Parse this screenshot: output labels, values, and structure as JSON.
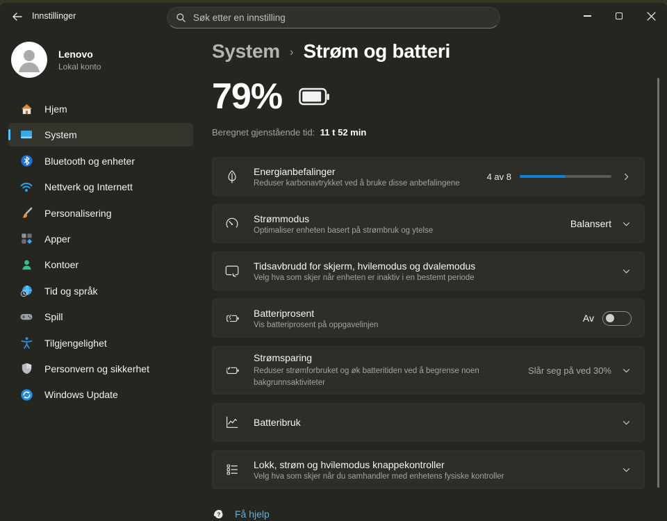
{
  "colors": {
    "accent": "#4cc2ff",
    "progress": "#1180d8",
    "link": "#61b2d8"
  },
  "window": {
    "title": "Innstillinger",
    "search_placeholder": "Søk etter en innstilling"
  },
  "account": {
    "name": "Lenovo",
    "type": "Lokal konto"
  },
  "sidebar": {
    "items": [
      {
        "label": "Hjem",
        "icon": "home-icon",
        "selected": false
      },
      {
        "label": "System",
        "icon": "system-icon",
        "selected": true
      },
      {
        "label": "Bluetooth og enheter",
        "icon": "bluetooth-icon",
        "selected": false
      },
      {
        "label": "Nettverk og Internett",
        "icon": "network-icon",
        "selected": false
      },
      {
        "label": "Personalisering",
        "icon": "personalization-icon",
        "selected": false
      },
      {
        "label": "Apper",
        "icon": "apps-icon",
        "selected": false
      },
      {
        "label": "Kontoer",
        "icon": "accounts-icon",
        "selected": false
      },
      {
        "label": "Tid og språk",
        "icon": "time-language-icon",
        "selected": false
      },
      {
        "label": "Spill",
        "icon": "gaming-icon",
        "selected": false
      },
      {
        "label": "Tilgjengelighet",
        "icon": "accessibility-icon",
        "selected": false
      },
      {
        "label": "Personvern og sikkerhet",
        "icon": "privacy-icon",
        "selected": false
      },
      {
        "label": "Windows Update",
        "icon": "windows-update-icon",
        "selected": false
      }
    ]
  },
  "breadcrumb": {
    "parent": "System",
    "separator": "›",
    "current": "Strøm og batteri"
  },
  "battery": {
    "percent": "79%",
    "remaining_label": "Beregnet gjenstående tid:",
    "remaining_value": "11 t 52 min"
  },
  "cards": [
    {
      "icon": "leaf-icon",
      "title": "Energianbefalinger",
      "subtitle": "Reduser karbonavtrykket ved å bruke disse anbefalingene",
      "value": "4 av 8",
      "progress": {
        "current": 4,
        "total": 8
      },
      "control": "chevron-right"
    },
    {
      "icon": "gauge-icon",
      "title": "Strømmodus",
      "subtitle": "Optimaliser enheten basert på strømbruk og ytelse",
      "value": "Balansert",
      "control": "chevron-down"
    },
    {
      "icon": "screen-moon-icon",
      "title": "Tidsavbrudd for skjerm, hvilemodus og dvalemodus",
      "subtitle": "Velg hva som skjer når enheten er inaktiv i en bestemt periode",
      "control": "chevron-down"
    },
    {
      "icon": "battery-bolt-icon",
      "title": "Batteriprosent",
      "subtitle": "Vis batteriprosent på oppgavelinjen",
      "value": "Av",
      "toggle_on": false,
      "control": "toggle"
    },
    {
      "icon": "battery-leaf-icon",
      "title": "Strømsparing",
      "subtitle": "Reduser strømforbruket og øk batteritiden ved å begrense noen bakgrunnsaktiviteter",
      "value": "Slår seg på ved 30%",
      "control": "chevron-down"
    },
    {
      "icon": "chart-icon",
      "title": "Batteribruk",
      "control": "chevron-down"
    },
    {
      "icon": "controls-icon",
      "title": "Lokk, strøm og hvilemodus knappekontroller",
      "subtitle": "Velg hva som skjer når du samhandler med enhetens fysiske kontroller",
      "control": "chevron-down"
    }
  ],
  "footer": {
    "help_label": "Få hjelp"
  }
}
